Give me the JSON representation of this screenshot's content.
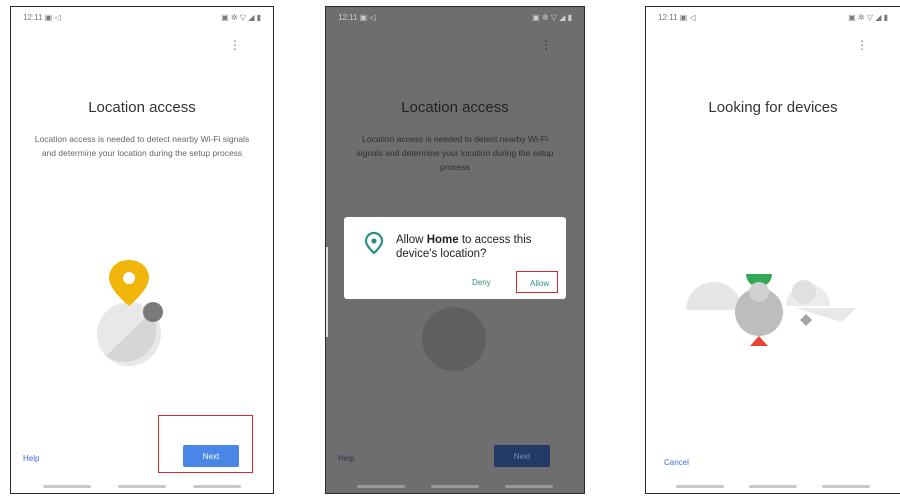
{
  "status_bar": {
    "time": "12:11",
    "left_icons": "▣ ◁",
    "right_icons": "▣ ✲ ▽ ◢ ▮"
  },
  "screen1": {
    "title": "Location access",
    "description": "Location access is needed to detect nearby Wi-Fi signals and determine your location during the setup process",
    "help_label": "Help",
    "next_label": "Next"
  },
  "screen2": {
    "title": "Location access",
    "description": "Location access is needed to detect nearby Wi-Fi signals and determine your location during the setup process",
    "dialog": {
      "prefix": "Allow ",
      "app_name": "Home",
      "suffix": " to access this device's location?",
      "deny_label": "Deny",
      "allow_label": "Allow"
    },
    "help_label": "Help",
    "next_label": "Next"
  },
  "screen3": {
    "title": "Looking for devices",
    "cancel_label": "Cancel"
  },
  "colors": {
    "accent_blue": "#4a86e8",
    "highlight_red": "#d9272f",
    "pin_yellow": "#f2b50a",
    "dialog_teal": "#2d8f84",
    "device_green": "#34a853",
    "device_red": "#ea4335"
  }
}
